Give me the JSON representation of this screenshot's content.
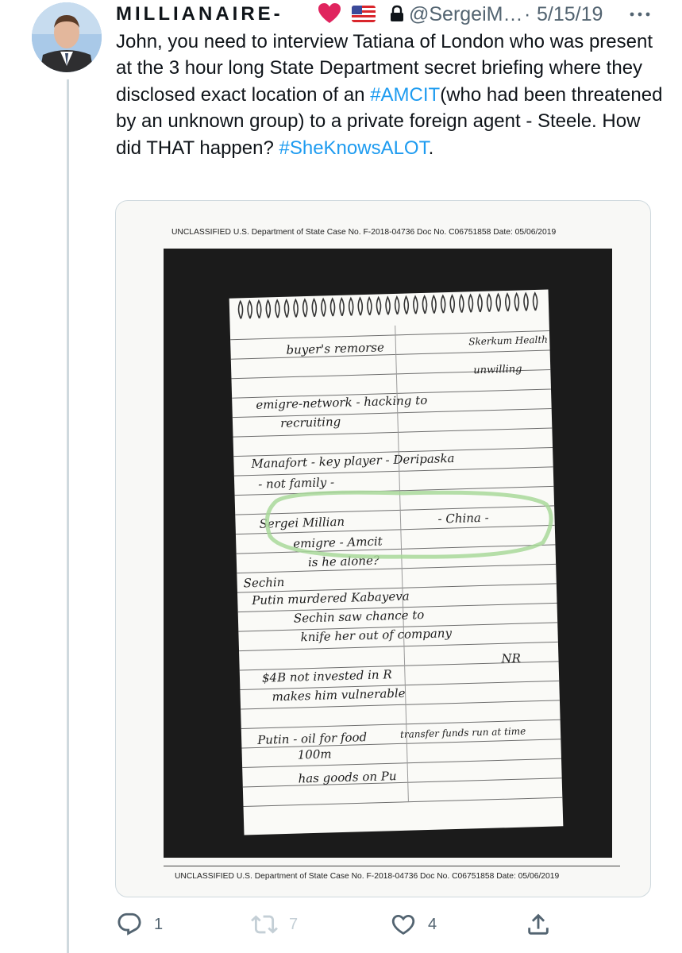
{
  "tweet": {
    "display_name": "MILLIANAIRE-",
    "handle": "@SergeiM…",
    "separator": "·",
    "date": "5/15/19",
    "text_parts": [
      "John, you need to interview Tatiana of London who was present at the 3 hour long State Department secret briefing where they disclosed exact location of an ",
      "#AMCIT",
      "(who had been threatened by an unknown group) to a private foreign agent - Steele. How did THAT happen? ",
      "#SheKnowsALOT",
      "."
    ],
    "icons": [
      "red-heart-icon",
      "us-flag-icon",
      "lock-icon",
      "more-icon"
    ]
  },
  "media": {
    "header_text": "UNCLASSIFIED U.S. Department of State Case No. F-2018-04736 Doc No. C06751858 Date: 05/06/2019",
    "footer_text": "UNCLASSIFIED U.S. Department of State Case No. F-2018-04736 Doc No. C06751858 Date: 05/06/2019",
    "handwritten_lines": [
      "buyer's remorse",
      "Skerkum Health",
      "unwilling",
      "emigre-network - hacking to",
      "recruiting",
      "Manafort - key player - Deripaska",
      "- not family -",
      "Sergei Millian",
      "- China -",
      "emigre - Amcit",
      "is he alone?",
      "Sechin",
      "Putin murdered Kabayeva",
      "Sechin saw chance to",
      "knife her out of company",
      "$4B not invested in R",
      "makes him vulnerable",
      "NR",
      "Putin - oil for food",
      "100m",
      "has goods on Pu",
      "transfer funds run at time"
    ]
  },
  "actions": {
    "reply_count": "1",
    "retweet_count": "7",
    "like_count": "4",
    "icons": [
      "reply-icon",
      "retweet-icon",
      "like-icon",
      "share-icon"
    ]
  },
  "colors": {
    "hashtag": "#1d9bf0",
    "secondary_text": "#536471",
    "border": "#cfd9de",
    "highlight": "#a8d89a"
  }
}
